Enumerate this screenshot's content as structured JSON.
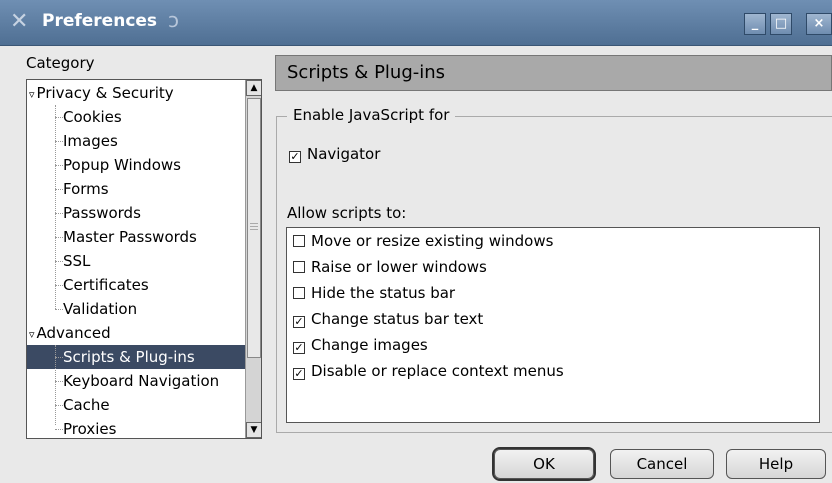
{
  "window": {
    "title": "Preferences",
    "minimize": "_",
    "maximize": "□",
    "close": "×"
  },
  "category": {
    "label": "Category",
    "items": [
      {
        "label": "Privacy & Security",
        "type": "group",
        "expanded": true,
        "glyph": "▿"
      },
      {
        "label": "Cookies",
        "type": "child"
      },
      {
        "label": "Images",
        "type": "child"
      },
      {
        "label": "Popup Windows",
        "type": "child"
      },
      {
        "label": "Forms",
        "type": "child"
      },
      {
        "label": "Passwords",
        "type": "child"
      },
      {
        "label": "Master Passwords",
        "type": "child"
      },
      {
        "label": "SSL",
        "type": "child"
      },
      {
        "label": "Certificates",
        "type": "child"
      },
      {
        "label": "Validation",
        "type": "child"
      },
      {
        "label": "Advanced",
        "type": "group",
        "expanded": true,
        "glyph": "▿"
      },
      {
        "label": "Scripts & Plug-ins",
        "type": "child",
        "selected": true
      },
      {
        "label": "Keyboard Navigation",
        "type": "child"
      },
      {
        "label": "Cache",
        "type": "child"
      },
      {
        "label": "Proxies",
        "type": "child"
      }
    ]
  },
  "panel": {
    "title": "Scripts & Plug-ins",
    "enable_js_group": "Enable JavaScript for",
    "navigator": {
      "label": "Navigator",
      "checked": true
    },
    "allow_label": "Allow scripts to:",
    "allow_items": [
      {
        "label": "Move or resize existing windows",
        "checked": false
      },
      {
        "label": "Raise or lower windows",
        "checked": false
      },
      {
        "label": "Hide the status bar",
        "checked": false
      },
      {
        "label": "Change status bar text",
        "checked": true
      },
      {
        "label": "Change images",
        "checked": true
      },
      {
        "label": "Disable or replace context menus",
        "checked": true
      }
    ]
  },
  "buttons": {
    "ok": "OK",
    "cancel": "Cancel",
    "help": "Help"
  },
  "colors": {
    "titlebar": "#5f7fa3",
    "selection": "#3b4a63",
    "header": "#a9a9a9"
  }
}
